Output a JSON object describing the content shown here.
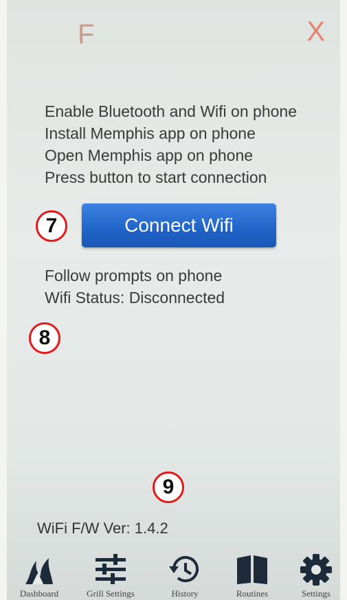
{
  "header": {
    "left_letter": "F",
    "close_label": "X"
  },
  "instructions": [
    "Enable Bluetooth and Wifi on phone",
    "Install Memphis app on phone",
    "Open Memphis app on phone",
    "Press button to start connection"
  ],
  "connect_button": {
    "label": "Connect Wifi"
  },
  "status": {
    "prompt": "Follow prompts on phone",
    "wifi_status": "Wifi Status: Disconnected"
  },
  "callouts": [
    "7",
    "8",
    "9"
  ],
  "version": "WiFi F/W Ver: 1.4.2",
  "nav": [
    {
      "label": "Dashboard",
      "icon": "flame-icon"
    },
    {
      "label": "Grill Settings",
      "icon": "sliders-icon"
    },
    {
      "label": "History",
      "icon": "history-icon"
    },
    {
      "label": "Routines",
      "icon": "book-icon"
    },
    {
      "label": "Settings",
      "icon": "gear-icon"
    }
  ],
  "colors": {
    "button": "#1f63c8",
    "callout_border": "#e11a1a",
    "close": "#e4826f"
  }
}
